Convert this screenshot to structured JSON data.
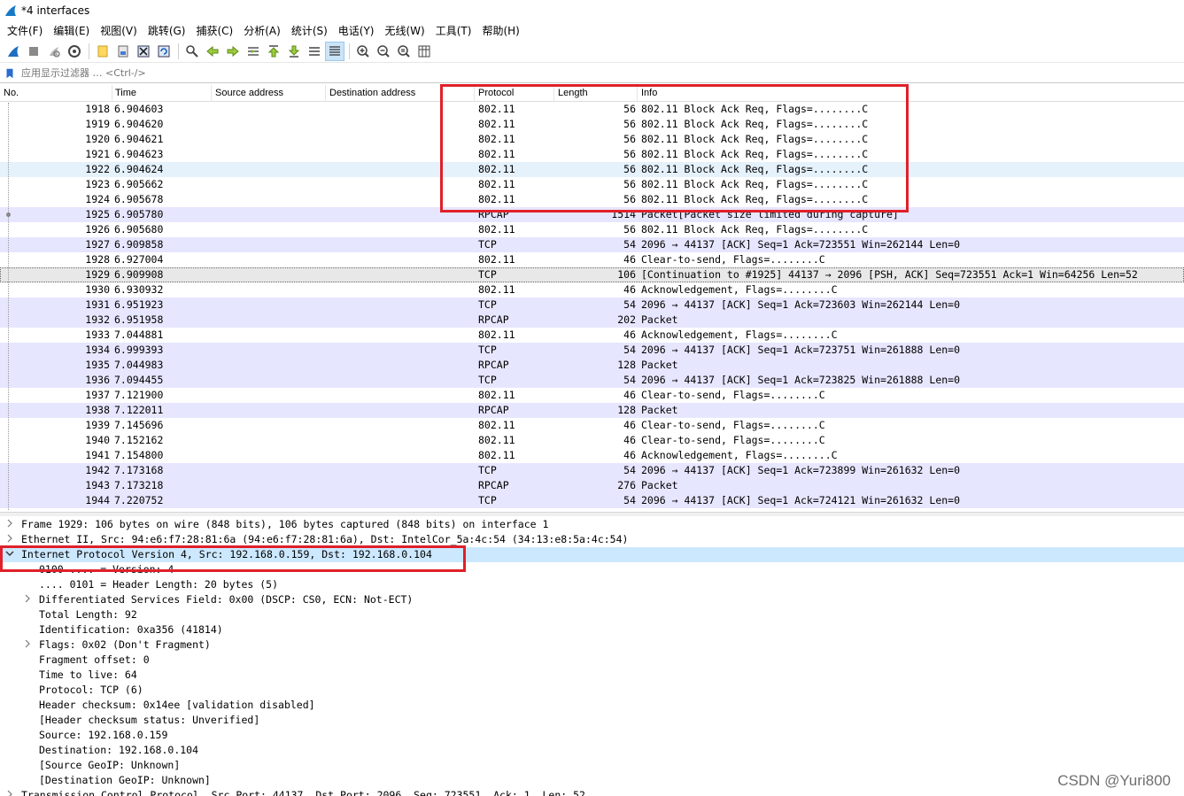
{
  "window": {
    "title": "*4 interfaces"
  },
  "menu": [
    "文件(F)",
    "编辑(E)",
    "视图(V)",
    "跳转(G)",
    "捕获(C)",
    "分析(A)",
    "统计(S)",
    "电话(Y)",
    "无线(W)",
    "工具(T)",
    "帮助(H)"
  ],
  "toolbar": {
    "icons": [
      "shark-fin-start-icon",
      "stop-icon",
      "restart-icon",
      "options-gear-icon",
      "open-folder-icon",
      "save-file-icon",
      "close-file-icon",
      "reload-icon",
      "find-icon",
      "back-arrow-icon",
      "forward-arrow-icon",
      "goto-packet-icon",
      "first-packet-icon",
      "last-packet-icon",
      "autoscroll-icon",
      "colorize-icon",
      "zoom-in-icon",
      "zoom-out-icon",
      "zoom-normal-icon",
      "resize-columns-icon"
    ]
  },
  "filter": {
    "placeholder": "应用显示过滤器 … <Ctrl-/>"
  },
  "columns": {
    "no": "No.",
    "time": "Time",
    "src": "Source address",
    "dst": "Destination address",
    "proto": "Protocol",
    "len": "Length",
    "info": "Info"
  },
  "packets": [
    {
      "no": "1918",
      "time": "6.904603",
      "proto": "802.11",
      "len": "56",
      "info": "802.11 Block Ack Req, Flags=........C",
      "style": "white"
    },
    {
      "no": "1919",
      "time": "6.904620",
      "proto": "802.11",
      "len": "56",
      "info": "802.11 Block Ack Req, Flags=........C",
      "style": "white"
    },
    {
      "no": "1920",
      "time": "6.904621",
      "proto": "802.11",
      "len": "56",
      "info": "802.11 Block Ack Req, Flags=........C",
      "style": "white"
    },
    {
      "no": "1921",
      "time": "6.904623",
      "proto": "802.11",
      "len": "56",
      "info": "802.11 Block Ack Req, Flags=........C",
      "style": "white"
    },
    {
      "no": "1922",
      "time": "6.904624",
      "proto": "802.11",
      "len": "56",
      "info": "802.11 Block Ack Req, Flags=........C",
      "style": "hover"
    },
    {
      "no": "1923",
      "time": "6.905662",
      "proto": "802.11",
      "len": "56",
      "info": "802.11 Block Ack Req, Flags=........C",
      "style": "white"
    },
    {
      "no": "1924",
      "time": "6.905678",
      "proto": "802.11",
      "len": "56",
      "info": "802.11 Block Ack Req, Flags=........C",
      "style": "white"
    },
    {
      "no": "1925",
      "time": "6.905780",
      "proto": "RPCAP",
      "len": "1514",
      "info": "Packet[Packet size limited during capture]",
      "style": "lav"
    },
    {
      "no": "1926",
      "time": "6.905680",
      "proto": "802.11",
      "len": "56",
      "info": "802.11 Block Ack Req, Flags=........C",
      "style": "white"
    },
    {
      "no": "1927",
      "time": "6.909858",
      "proto": "TCP",
      "len": "54",
      "info": "2096 → 44137 [ACK] Seq=1 Ack=723551 Win=262144 Len=0",
      "style": "lav"
    },
    {
      "no": "1928",
      "time": "6.927004",
      "proto": "802.11",
      "len": "46",
      "info": "Clear-to-send, Flags=........C",
      "style": "white"
    },
    {
      "no": "1929",
      "time": "6.909908",
      "proto": "TCP",
      "len": "106",
      "info": "[Continuation to #1925] 44137 → 2096 [PSH, ACK] Seq=723551 Ack=1 Win=64256 Len=52",
      "style": "sel"
    },
    {
      "no": "1930",
      "time": "6.930932",
      "proto": "802.11",
      "len": "46",
      "info": "Acknowledgement, Flags=........C",
      "style": "white"
    },
    {
      "no": "1931",
      "time": "6.951923",
      "proto": "TCP",
      "len": "54",
      "info": "2096 → 44137 [ACK] Seq=1 Ack=723603 Win=262144 Len=0",
      "style": "lav"
    },
    {
      "no": "1932",
      "time": "6.951958",
      "proto": "RPCAP",
      "len": "202",
      "info": "Packet",
      "style": "lav"
    },
    {
      "no": "1933",
      "time": "7.044881",
      "proto": "802.11",
      "len": "46",
      "info": "Acknowledgement, Flags=........C",
      "style": "white"
    },
    {
      "no": "1934",
      "time": "6.999393",
      "proto": "TCP",
      "len": "54",
      "info": "2096 → 44137 [ACK] Seq=1 Ack=723751 Win=261888 Len=0",
      "style": "lav"
    },
    {
      "no": "1935",
      "time": "7.044983",
      "proto": "RPCAP",
      "len": "128",
      "info": "Packet",
      "style": "lav"
    },
    {
      "no": "1936",
      "time": "7.094455",
      "proto": "TCP",
      "len": "54",
      "info": "2096 → 44137 [ACK] Seq=1 Ack=723825 Win=261888 Len=0",
      "style": "lav"
    },
    {
      "no": "1937",
      "time": "7.121900",
      "proto": "802.11",
      "len": "46",
      "info": "Clear-to-send, Flags=........C",
      "style": "white"
    },
    {
      "no": "1938",
      "time": "7.122011",
      "proto": "RPCAP",
      "len": "128",
      "info": "Packet",
      "style": "lav"
    },
    {
      "no": "1939",
      "time": "7.145696",
      "proto": "802.11",
      "len": "46",
      "info": "Clear-to-send, Flags=........C",
      "style": "white"
    },
    {
      "no": "1940",
      "time": "7.152162",
      "proto": "802.11",
      "len": "46",
      "info": "Clear-to-send, Flags=........C",
      "style": "white"
    },
    {
      "no": "1941",
      "time": "7.154800",
      "proto": "802.11",
      "len": "46",
      "info": "Acknowledgement, Flags=........C",
      "style": "white"
    },
    {
      "no": "1942",
      "time": "7.173168",
      "proto": "TCP",
      "len": "54",
      "info": "2096 → 44137 [ACK] Seq=1 Ack=723899 Win=261632 Len=0",
      "style": "lav"
    },
    {
      "no": "1943",
      "time": "7.173218",
      "proto": "RPCAP",
      "len": "276",
      "info": "Packet",
      "style": "lav"
    },
    {
      "no": "1944",
      "time": "7.220752",
      "proto": "TCP",
      "len": "54",
      "info": "2096 → 44137 [ACK] Seq=1 Ack=724121 Win=261632 Len=0",
      "style": "lav"
    }
  ],
  "details": [
    {
      "text": "Frame 1929: 106 bytes on wire (848 bits), 106 bytes captured (848 bits) on interface 1",
      "level": 0,
      "arrow": "collapsed"
    },
    {
      "text": "Ethernet II, Src: 94:e6:f7:28:81:6a (94:e6:f7:28:81:6a), Dst: IntelCor_5a:4c:54 (34:13:e8:5a:4c:54)",
      "level": 0,
      "arrow": "collapsed"
    },
    {
      "text": "Internet Protocol Version 4, Src: 192.168.0.159, Dst: 192.168.0.104",
      "level": 0,
      "arrow": "expanded",
      "selected": true
    },
    {
      "text": "0100 .... = Version: 4",
      "level": 1,
      "arrow": "none"
    },
    {
      "text": ".... 0101 = Header Length: 20 bytes (5)",
      "level": 1,
      "arrow": "none"
    },
    {
      "text": "Differentiated Services Field: 0x00 (DSCP: CS0, ECN: Not-ECT)",
      "level": 1,
      "arrow": "collapsed"
    },
    {
      "text": "Total Length: 92",
      "level": 1,
      "arrow": "none"
    },
    {
      "text": "Identification: 0xa356 (41814)",
      "level": 1,
      "arrow": "none"
    },
    {
      "text": "Flags: 0x02 (Don't Fragment)",
      "level": 1,
      "arrow": "collapsed"
    },
    {
      "text": "Fragment offset: 0",
      "level": 1,
      "arrow": "none"
    },
    {
      "text": "Time to live: 64",
      "level": 1,
      "arrow": "none"
    },
    {
      "text": "Protocol: TCP (6)",
      "level": 1,
      "arrow": "none"
    },
    {
      "text": "Header checksum: 0x14ee [validation disabled]",
      "level": 1,
      "arrow": "none"
    },
    {
      "text": "[Header checksum status: Unverified]",
      "level": 1,
      "arrow": "none"
    },
    {
      "text": "Source: 192.168.0.159",
      "level": 1,
      "arrow": "none"
    },
    {
      "text": "Destination: 192.168.0.104",
      "level": 1,
      "arrow": "none"
    },
    {
      "text": "[Source GeoIP: Unknown]",
      "level": 1,
      "arrow": "none"
    },
    {
      "text": "[Destination GeoIP: Unknown]",
      "level": 1,
      "arrow": "none"
    },
    {
      "text": "Transmission Control Protocol, Src Port: 44137, Dst Port: 2096, Seq: 723551, Ack: 1, Len: 52",
      "level": 0,
      "arrow": "collapsed"
    }
  ],
  "watermark": "CSDN @Yuri800",
  "colors": {
    "highlight_box": "#e0202a",
    "row_lavender": "#e7e6ff",
    "row_selected_detail": "#cce8ff"
  }
}
